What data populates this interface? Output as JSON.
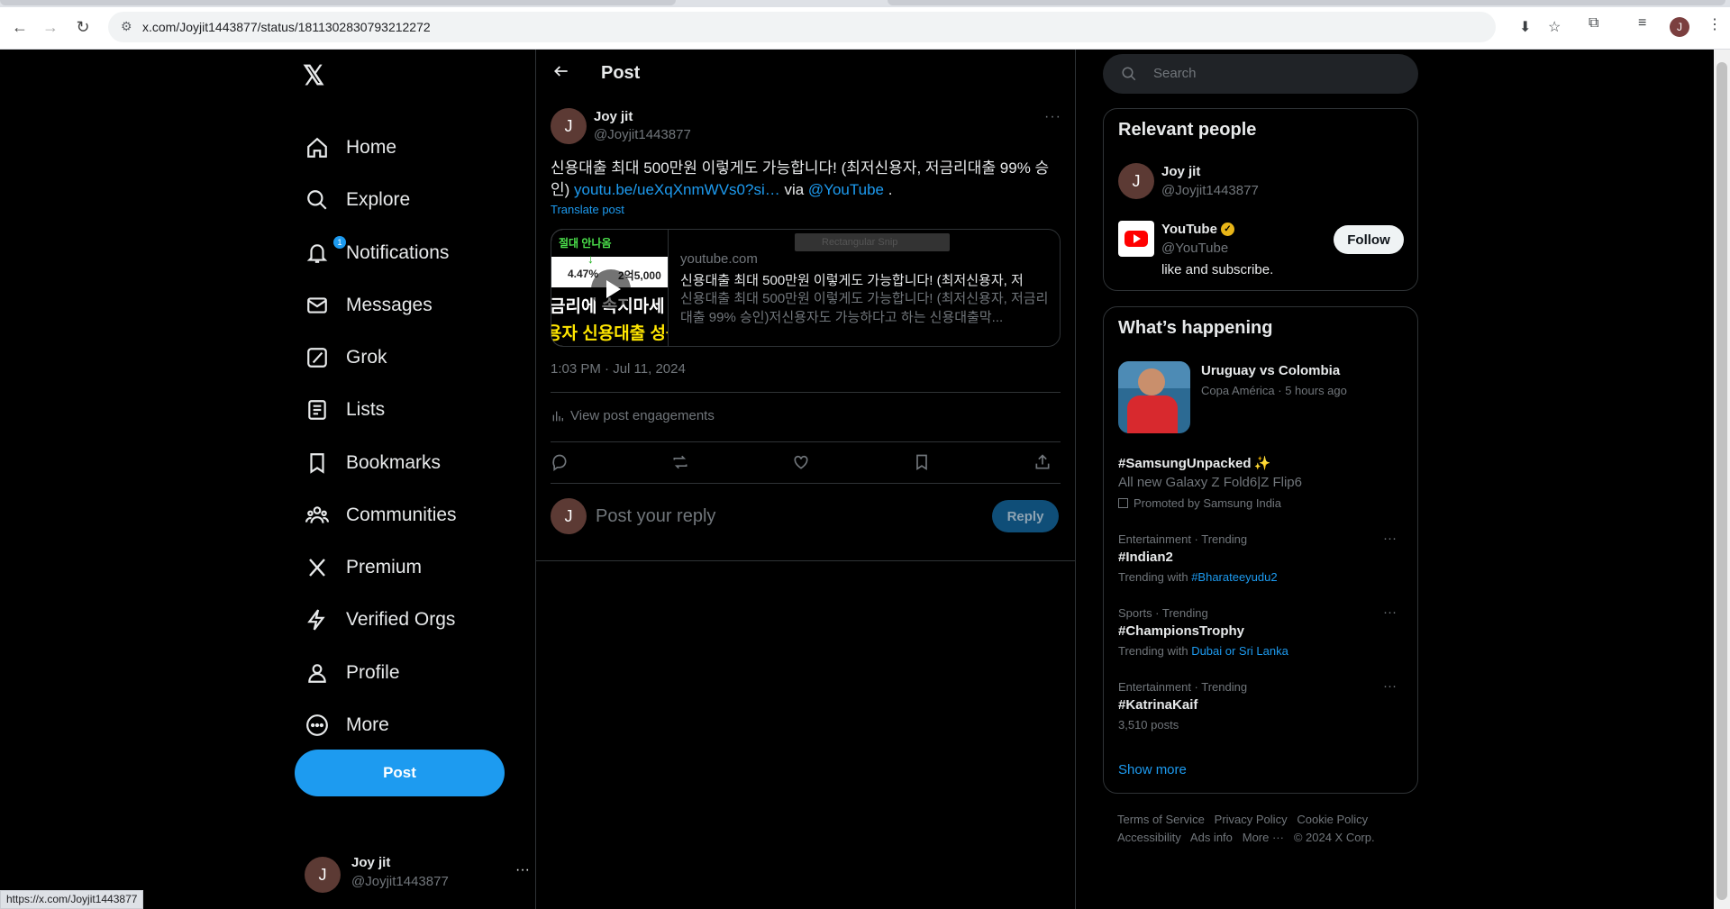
{
  "browser": {
    "url": "x.com/Joyjit1443877/status/1811302830793212272",
    "profile_initial": "J",
    "status_bar_url": "https://x.com/Joyjit1443877"
  },
  "sidebar": {
    "logo": "𝕏",
    "items": [
      {
        "label": "Home",
        "icon": "home-icon"
      },
      {
        "label": "Explore",
        "icon": "search-icon"
      },
      {
        "label": "Notifications",
        "icon": "bell-icon",
        "badge": "1"
      },
      {
        "label": "Messages",
        "icon": "envelope-icon"
      },
      {
        "label": "Grok",
        "icon": "grok-icon"
      },
      {
        "label": "Lists",
        "icon": "list-icon"
      },
      {
        "label": "Bookmarks",
        "icon": "bookmark-icon"
      },
      {
        "label": "Communities",
        "icon": "communities-icon"
      },
      {
        "label": "Premium",
        "icon": "x-logo-icon"
      },
      {
        "label": "Verified Orgs",
        "icon": "lightning-icon"
      },
      {
        "label": "Profile",
        "icon": "person-icon"
      },
      {
        "label": "More",
        "icon": "more-circle-icon"
      }
    ],
    "post_button": "Post",
    "account": {
      "name": "Joy jit",
      "handle": "@Joyjit1443877",
      "initial": "J"
    }
  },
  "main": {
    "header_title": "Post",
    "tweet": {
      "author_name": "Joy jit",
      "author_handle": "@Joyjit1443877",
      "author_initial": "J",
      "text": "신용대출 최대 500만원 이렇게도 가능합니다! (최저신용자, 저금리대출 99% 승인)",
      "link": "youtu.be/ueXqXnmWVs0?si…",
      "via": "via",
      "mention": "@YouTube",
      "period": ".",
      "translate": "Translate post",
      "card": {
        "domain": "youtube.com",
        "title": "신용대출 최대 500만원 이렇게도 가능합니다! (최저신용자, 저",
        "description": "신용대출 최대 500만원 이렇게도 가능합니다! (최저신용자, 저금리대출 99% 승인)저신용자도 가능하다고 하는 신용대출막...",
        "thumb_top": "절대 안나옴",
        "thumb_rate1": "4.47%",
        "thumb_rate2": "2억5,000",
        "thumb_line1": "금리에 속지마세",
        "thumb_line2": "용자 신용대출 성공",
        "snip_overlay": "Rectangular Snip"
      },
      "timestamp": "1:03 PM · Jul 11, 2024",
      "engagements": "View post engagements"
    },
    "reply": {
      "placeholder": "Post your reply",
      "button": "Reply",
      "initial": "J"
    }
  },
  "right": {
    "search_placeholder": "Search",
    "relevant": {
      "title": "Relevant people",
      "people": [
        {
          "name": "Joy jit",
          "handle": "@Joyjit1443877",
          "initial": "J"
        },
        {
          "name": "YouTube",
          "handle": "@YouTube",
          "bio": "like and subscribe.",
          "follow": "Follow"
        }
      ]
    },
    "happening": {
      "title": "What’s happening",
      "featured": {
        "title": "Uruguay vs Colombia",
        "meta": "Copa América · 5 hours ago"
      },
      "promoted": {
        "tag": "#SamsungUnpacked",
        "desc": "All new Galaxy Z Fold6|Z Flip6",
        "by": "Promoted by Samsung India"
      },
      "trends": [
        {
          "category": "Entertainment · Trending",
          "tag": "#Indian2",
          "prefix": "Trending with",
          "with": "#Bharateeyudu2"
        },
        {
          "category": "Sports · Trending",
          "tag": "#ChampionsTrophy",
          "prefix": "Trending with",
          "with": "Dubai or Sri Lanka"
        },
        {
          "category": "Entertainment · Trending",
          "tag": "#KatrinaKaif",
          "posts": "3,510 posts"
        }
      ],
      "show_more": "Show more"
    },
    "footer": {
      "links": [
        "Terms of Service",
        "Privacy Policy",
        "Cookie Policy",
        "Accessibility",
        "Ads info",
        "More ···"
      ],
      "copyright": "© 2024 X Corp."
    }
  }
}
